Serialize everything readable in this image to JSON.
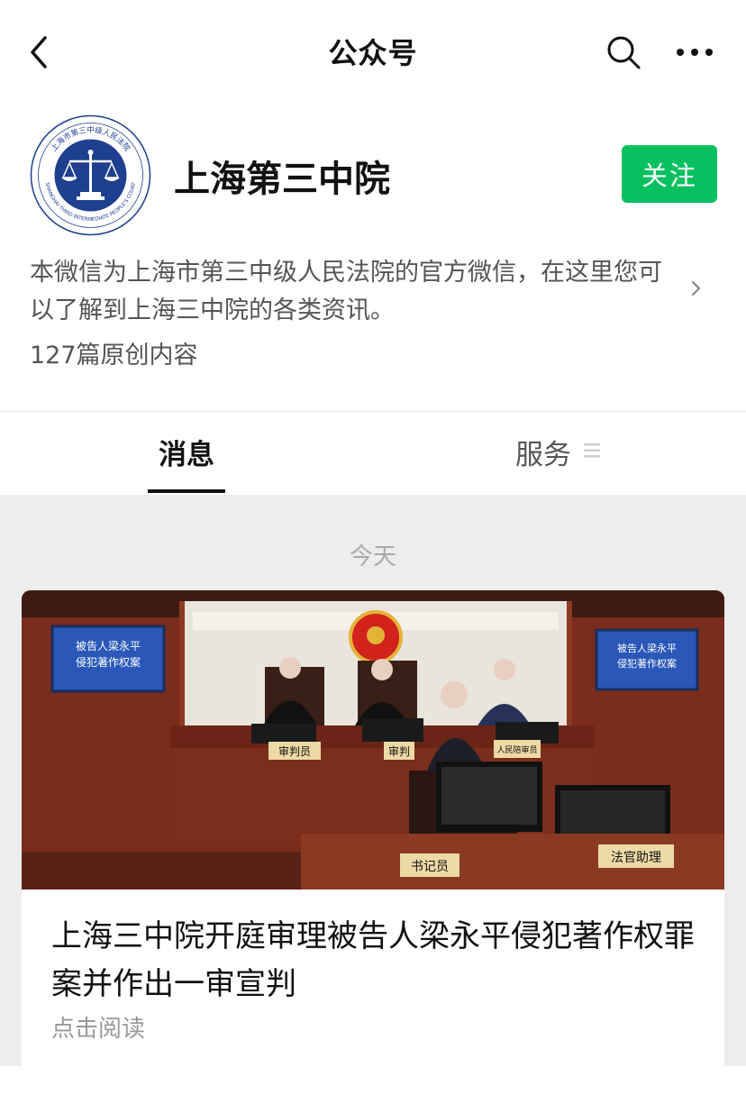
{
  "nav": {
    "title": "公众号"
  },
  "profile": {
    "name": "上海第三中院",
    "follow_label": "关注",
    "description": "本微信为上海市第三中级人民法院的官方微信，在这里您可以了解到上海三中院的各类资讯。",
    "original_count": "127篇原创内容",
    "logo_text_top": "上海市第三中级人民法院",
    "logo_text_bottom": "SHANGHAI THIRD INTERMEDIATE PEOPLE'S COURT"
  },
  "tabs": [
    {
      "label": "消息",
      "active": true
    },
    {
      "label": "服务",
      "active": false
    }
  ],
  "feed": {
    "date_label": "今天",
    "article": {
      "title": "上海三中院开庭审理被告人梁永平侵犯著作权罪案并作出一审宣判",
      "read_label": "点击阅读",
      "cover": {
        "screen_left_text": "被告人梁永平\n侵犯著作权案",
        "screen_right_text": "被告人梁永平\n侵犯著作权案",
        "sign_judge": "审判员",
        "sign_judge2": "审判",
        "sign_juror": "人民陪审员",
        "sign_clerk": "书记员",
        "sign_assistant": "法官助理"
      }
    }
  },
  "colors": {
    "accent": "#07c160",
    "feed_bg": "#ededed"
  }
}
